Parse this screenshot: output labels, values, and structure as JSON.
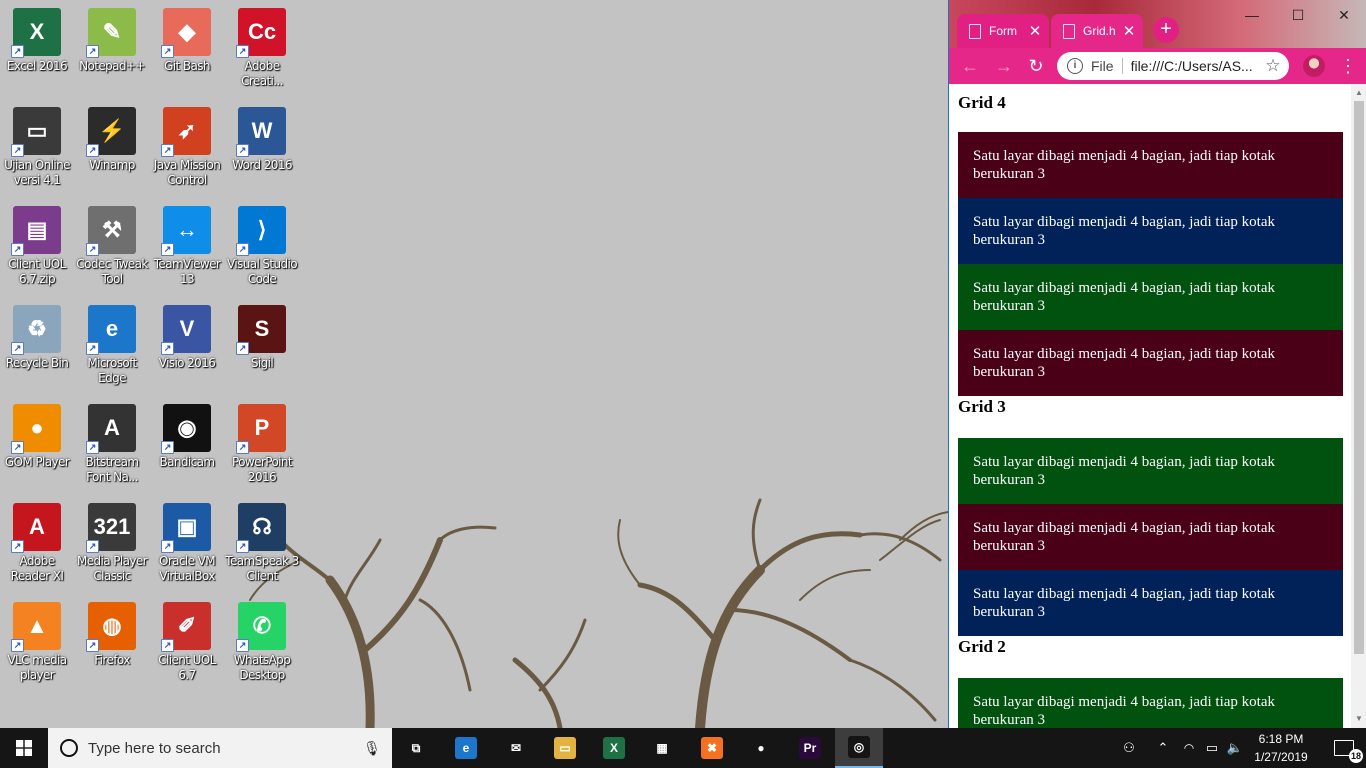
{
  "desktop": {
    "icons": [
      {
        "label": "Excel 2016",
        "glyph": "X",
        "color": "#1e7145"
      },
      {
        "label": "Notepad++",
        "glyph": "✎",
        "color": "#8dbb4a"
      },
      {
        "label": "Git Bash",
        "glyph": "◆",
        "color": "#e86a5a"
      },
      {
        "label": "Adobe Creati...",
        "glyph": "Cc",
        "color": "#d1132a"
      },
      {
        "label": "Ujian Online versi 4.1",
        "glyph": "▭",
        "color": "#3a3a3a"
      },
      {
        "label": "Winamp",
        "glyph": "⚡",
        "color": "#2b2b2b"
      },
      {
        "label": "Java Mission Control",
        "glyph": "➶",
        "color": "#d2411f"
      },
      {
        "label": "Word 2016",
        "glyph": "W",
        "color": "#2b5797"
      },
      {
        "label": "Client UOL 6.7.zip",
        "glyph": "▤",
        "color": "#7b3c8c"
      },
      {
        "label": "Codec Tweak Tool",
        "glyph": "⚒",
        "color": "#6f6f6f"
      },
      {
        "label": "TeamViewer 13",
        "glyph": "↔",
        "color": "#0e8ee9"
      },
      {
        "label": "Visual Studio Code",
        "glyph": "⟩",
        "color": "#0078d4"
      },
      {
        "label": "Recycle Bin",
        "glyph": "♻",
        "color": "#8aa6bd"
      },
      {
        "label": "Microsoft Edge",
        "glyph": "e",
        "color": "#1c76c9"
      },
      {
        "label": "Visio 2016",
        "glyph": "V",
        "color": "#3955a3"
      },
      {
        "label": "Sigil",
        "glyph": "S",
        "color": "#5a1414"
      },
      {
        "label": "GOM Player",
        "glyph": "●",
        "color": "#f08c00"
      },
      {
        "label": "Bitstream Font Na...",
        "glyph": "A",
        "color": "#333333"
      },
      {
        "label": "Bandicam",
        "glyph": "◉",
        "color": "#111111"
      },
      {
        "label": "PowerPoint 2016",
        "glyph": "P",
        "color": "#d24726"
      },
      {
        "label": "Adobe Reader XI",
        "glyph": "A",
        "color": "#c4161c"
      },
      {
        "label": "Media Player Classic",
        "glyph": "321",
        "color": "#3a3a3a"
      },
      {
        "label": "Oracle VM VirtualBox",
        "glyph": "▣",
        "color": "#1c5aa6"
      },
      {
        "label": "TeamSpeak 3 Client",
        "glyph": "☊",
        "color": "#1f3e63"
      },
      {
        "label": "VLC media player",
        "glyph": "▲",
        "color": "#f58220"
      },
      {
        "label": "Firefox",
        "glyph": "◍",
        "color": "#e66000"
      },
      {
        "label": "Client UOL 6.7",
        "glyph": "✐",
        "color": "#c9302c"
      },
      {
        "label": "WhatsApp Desktop",
        "glyph": "✆",
        "color": "#25d366"
      }
    ]
  },
  "browser": {
    "tabs": [
      {
        "title": "Form",
        "active": false
      },
      {
        "title": "Grid.h",
        "active": true
      }
    ],
    "new_tab_symbol": "+",
    "window_controls": {
      "minimize": "—",
      "maximize": "☐",
      "close": "✕"
    },
    "omnibox": {
      "chip": "File",
      "url": "file:///C:/Users/AS..."
    },
    "page": {
      "sections": [
        {
          "heading": "Grid 4",
          "boxes": [
            {
              "text": "Satu layar dibagi menjadi 4 bagian, jadi tiap kotak berukuran 3",
              "color": "#4a0017"
            },
            {
              "text": "Satu layar dibagi menjadi 4 bagian, jadi tiap kotak berukuran 3",
              "color": "#002258"
            },
            {
              "text": "Satu layar dibagi menjadi 4 bagian, jadi tiap kotak berukuran 3",
              "color": "#00520e"
            },
            {
              "text": "Satu layar dibagi menjadi 4 bagian, jadi tiap kotak berukuran 3",
              "color": "#4a0017"
            }
          ]
        },
        {
          "heading": "Grid 3",
          "boxes": [
            {
              "text": "Satu layar dibagi menjadi 4 bagian, jadi tiap kotak berukuran 3",
              "color": "#00520e"
            },
            {
              "text": "Satu layar dibagi menjadi 4 bagian, jadi tiap kotak berukuran 3",
              "color": "#4a0017"
            },
            {
              "text": "Satu layar dibagi menjadi 4 bagian, jadi tiap kotak berukuran 3",
              "color": "#002258"
            }
          ]
        },
        {
          "heading": "Grid 2",
          "boxes": [
            {
              "text": "Satu layar dibagi menjadi 4 bagian, jadi tiap kotak berukuran 3",
              "color": "#00520e"
            }
          ]
        }
      ]
    }
  },
  "taskbar": {
    "search_placeholder": "Type here to search",
    "apps": [
      {
        "name": "task-view",
        "glyph": "⧉",
        "color": "#151515"
      },
      {
        "name": "edge",
        "glyph": "e",
        "color": "#1c76c9"
      },
      {
        "name": "mail",
        "glyph": "✉",
        "color": "#151515"
      },
      {
        "name": "file-explorer",
        "glyph": "▭",
        "color": "#e3b341"
      },
      {
        "name": "excel",
        "glyph": "X",
        "color": "#1e7145"
      },
      {
        "name": "store",
        "glyph": "▦",
        "color": "#151515"
      },
      {
        "name": "xampp",
        "glyph": "✖",
        "color": "#f37121"
      },
      {
        "name": "bandicam",
        "glyph": "●",
        "color": "#151515"
      },
      {
        "name": "premiere",
        "glyph": "Pr",
        "color": "#2a0a3a"
      },
      {
        "name": "chrome",
        "glyph": "◎",
        "color": "#151515"
      }
    ],
    "clock": {
      "time": "6:18 PM",
      "date": "1/27/2019"
    },
    "notification_count": "18"
  }
}
